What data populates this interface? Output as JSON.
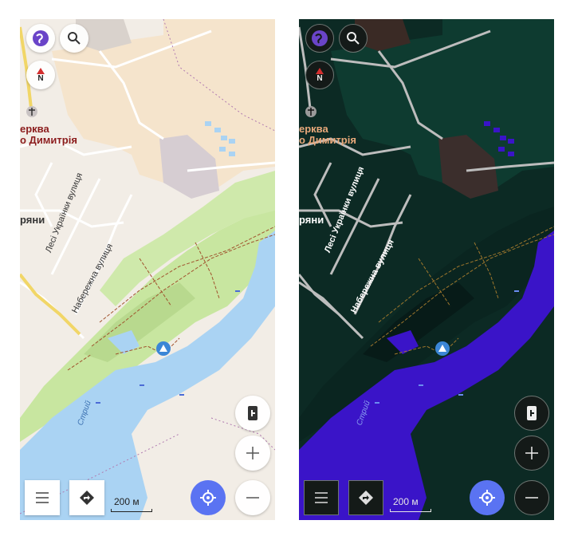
{
  "map": {
    "labels": {
      "church_line1": "ерква",
      "church_line2": "о Димитрія",
      "village": "ряни",
      "street1": "Лесі Українки вулиця",
      "street2": "Набережна вулиця",
      "river": "Стрий"
    },
    "scale_label": "200 м",
    "compass_label": "N",
    "icons": {
      "layers": "globe-icon",
      "search": "search-icon",
      "compass": "compass-icon",
      "menu": "menu-icon",
      "route": "route-icon",
      "gesture": "hand-pointer-icon",
      "zoom_in": "plus-icon",
      "zoom_out": "minus-icon",
      "locate": "crosshair-icon",
      "camp": "camp-icon"
    }
  },
  "themes": {
    "light": {
      "land": "#f2ede6",
      "residential": "#f7e6cd",
      "green": "#c9e7a2",
      "water": "#aad3f3",
      "road": "#ffffff",
      "yellow_road": "#f1d667"
    },
    "dark": {
      "land": "#0c2a24",
      "forest": "#0e3a2f",
      "water": "#3a14c8",
      "road": "#bdbdbd",
      "accent": "#5a73f2"
    }
  }
}
